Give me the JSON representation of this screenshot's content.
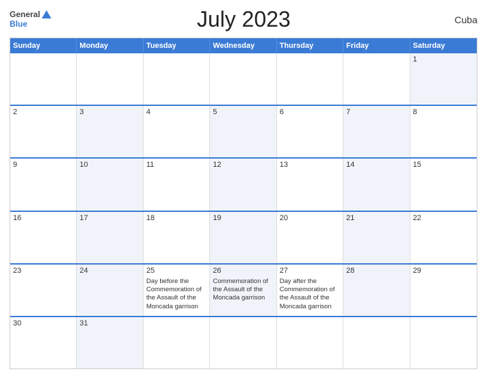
{
  "header": {
    "logo_line1": "General",
    "logo_line2": "Blue",
    "title": "July 2023",
    "country": "Cuba"
  },
  "calendar": {
    "weekdays": [
      "Sunday",
      "Monday",
      "Tuesday",
      "Wednesday",
      "Thursday",
      "Friday",
      "Saturday"
    ],
    "rows": [
      [
        {
          "day": "",
          "shaded": false,
          "events": []
        },
        {
          "day": "",
          "shaded": false,
          "events": []
        },
        {
          "day": "",
          "shaded": false,
          "events": []
        },
        {
          "day": "",
          "shaded": false,
          "events": []
        },
        {
          "day": "",
          "shaded": false,
          "events": []
        },
        {
          "day": "",
          "shaded": false,
          "events": []
        },
        {
          "day": "1",
          "shaded": true,
          "events": []
        }
      ],
      [
        {
          "day": "2",
          "shaded": false,
          "events": []
        },
        {
          "day": "3",
          "shaded": true,
          "events": []
        },
        {
          "day": "4",
          "shaded": false,
          "events": []
        },
        {
          "day": "5",
          "shaded": true,
          "events": []
        },
        {
          "day": "6",
          "shaded": false,
          "events": []
        },
        {
          "day": "7",
          "shaded": true,
          "events": []
        },
        {
          "day": "8",
          "shaded": false,
          "events": []
        }
      ],
      [
        {
          "day": "9",
          "shaded": false,
          "events": []
        },
        {
          "day": "10",
          "shaded": true,
          "events": []
        },
        {
          "day": "11",
          "shaded": false,
          "events": []
        },
        {
          "day": "12",
          "shaded": true,
          "events": []
        },
        {
          "day": "13",
          "shaded": false,
          "events": []
        },
        {
          "day": "14",
          "shaded": true,
          "events": []
        },
        {
          "day": "15",
          "shaded": false,
          "events": []
        }
      ],
      [
        {
          "day": "16",
          "shaded": false,
          "events": []
        },
        {
          "day": "17",
          "shaded": true,
          "events": []
        },
        {
          "day": "18",
          "shaded": false,
          "events": []
        },
        {
          "day": "19",
          "shaded": true,
          "events": []
        },
        {
          "day": "20",
          "shaded": false,
          "events": []
        },
        {
          "day": "21",
          "shaded": true,
          "events": []
        },
        {
          "day": "22",
          "shaded": false,
          "events": []
        }
      ],
      [
        {
          "day": "23",
          "shaded": false,
          "events": []
        },
        {
          "day": "24",
          "shaded": true,
          "events": []
        },
        {
          "day": "25",
          "shaded": false,
          "events": [
            "Day before the Commemoration of the Assault of the Moncada garrison"
          ]
        },
        {
          "day": "26",
          "shaded": true,
          "events": [
            "Commemoration of the Assault of the Moncada garrison"
          ]
        },
        {
          "day": "27",
          "shaded": false,
          "events": [
            "Day after the Commemoration of the Assault of the Moncada garrison"
          ]
        },
        {
          "day": "28",
          "shaded": true,
          "events": []
        },
        {
          "day": "29",
          "shaded": false,
          "events": []
        }
      ],
      [
        {
          "day": "30",
          "shaded": false,
          "events": []
        },
        {
          "day": "31",
          "shaded": true,
          "events": []
        },
        {
          "day": "",
          "shaded": false,
          "events": []
        },
        {
          "day": "",
          "shaded": false,
          "events": []
        },
        {
          "day": "",
          "shaded": false,
          "events": []
        },
        {
          "day": "",
          "shaded": false,
          "events": []
        },
        {
          "day": "",
          "shaded": false,
          "events": []
        }
      ]
    ]
  }
}
